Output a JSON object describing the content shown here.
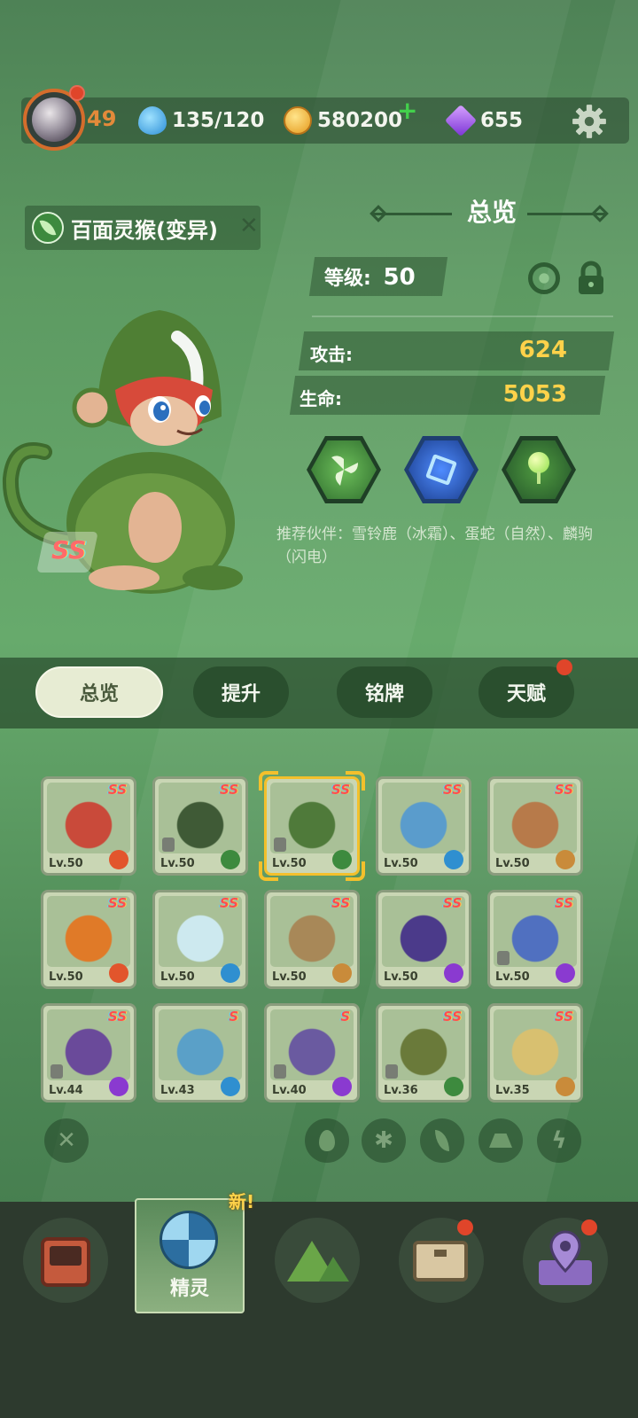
{
  "colors": {
    "accent_gold": "#ffd24a",
    "badge_red": "#e0452a",
    "level_orange": "#e38a3a"
  },
  "topbar": {
    "player_level": "49",
    "energy": "135/120",
    "coins": "580200",
    "gems": "655",
    "icons": {
      "energy": "water-drop-icon",
      "coins": "paw-coin-icon",
      "gems": "purple-gem-icon",
      "settings": "gear-icon",
      "add": "plus-icon"
    }
  },
  "creature": {
    "name": "百面灵猴(变异)",
    "rank": "SS",
    "element": "leaf"
  },
  "overview": {
    "title": "总览",
    "level_label": "等级:",
    "level_value": "50",
    "attack_label": "攻击:",
    "attack_value": "624",
    "hp_label": "生命:",
    "hp_value": "5053",
    "skills": [
      "wind-skill-icon",
      "blue-frame-skill-icon",
      "green-orb-skill-icon"
    ],
    "partner_text": "推荐伙伴：雪铃鹿（冰霜）、蛋蛇（自然）、麟驹（闪电）"
  },
  "tabs": [
    {
      "label": "总览",
      "active": true
    },
    {
      "label": "提升",
      "active": false
    },
    {
      "label": "铭牌",
      "active": false
    },
    {
      "label": "天赋",
      "active": false,
      "badge": true
    }
  ],
  "grid": [
    {
      "lv": "Lv.50",
      "rank": "SS",
      "element": "fire",
      "art": "#c94a3a",
      "locked": false
    },
    {
      "lv": "Lv.50",
      "rank": "SS",
      "element": "leaf",
      "art": "#3f5a36",
      "locked": true
    },
    {
      "lv": "Lv.50",
      "rank": "SS",
      "element": "leaf",
      "art": "#4f7a3a",
      "locked": true,
      "selected": true
    },
    {
      "lv": "Lv.50",
      "rank": "SS",
      "element": "ice",
      "art": "#5a9ccc",
      "locked": false
    },
    {
      "lv": "Lv.50",
      "rank": "SS",
      "element": "earth",
      "art": "#b77a4a",
      "locked": false
    },
    {
      "lv": "Lv.50",
      "rank": "SS",
      "element": "fire",
      "art": "#e07a28",
      "locked": false
    },
    {
      "lv": "Lv.50",
      "rank": "SS",
      "element": "ice",
      "art": "#cde9ef",
      "locked": false
    },
    {
      "lv": "Lv.50",
      "rank": "SS",
      "element": "earth",
      "art": "#a88858",
      "locked": false
    },
    {
      "lv": "Lv.50",
      "rank": "SS",
      "element": "lightning",
      "art": "#4b3a8a",
      "locked": false
    },
    {
      "lv": "Lv.50",
      "rank": "SS",
      "element": "lightning",
      "art": "#5070c0",
      "locked": true
    },
    {
      "lv": "Lv.44",
      "rank": "SS",
      "element": "lightning",
      "art": "#6a4a9a",
      "locked": true
    },
    {
      "lv": "Lv.43",
      "rank": "S",
      "element": "ice",
      "art": "#5aa0c8",
      "locked": false
    },
    {
      "lv": "Lv.40",
      "rank": "S",
      "element": "lightning",
      "art": "#6a5aa0",
      "locked": true
    },
    {
      "lv": "Lv.36",
      "rank": "SS",
      "element": "leaf",
      "art": "#6a7a3a",
      "locked": true
    },
    {
      "lv": "Lv.35",
      "rank": "SS",
      "element": "earth",
      "art": "#d8c070",
      "locked": false
    }
  ],
  "filters": [
    "clear-filter-icon",
    "fire-filter-icon",
    "ice-filter-icon",
    "leaf-filter-icon",
    "earth-filter-icon",
    "lightning-filter-icon"
  ],
  "nav": {
    "items": [
      {
        "icon": "console-icon",
        "badge": false
      },
      {
        "icon": "spirit-swirl-icon",
        "label": "精灵",
        "active": true,
        "new_tag": "新!"
      },
      {
        "icon": "mountain-icon",
        "badge": false
      },
      {
        "icon": "chest-icon",
        "badge": true
      },
      {
        "icon": "map-pin-icon",
        "badge": true
      }
    ]
  }
}
